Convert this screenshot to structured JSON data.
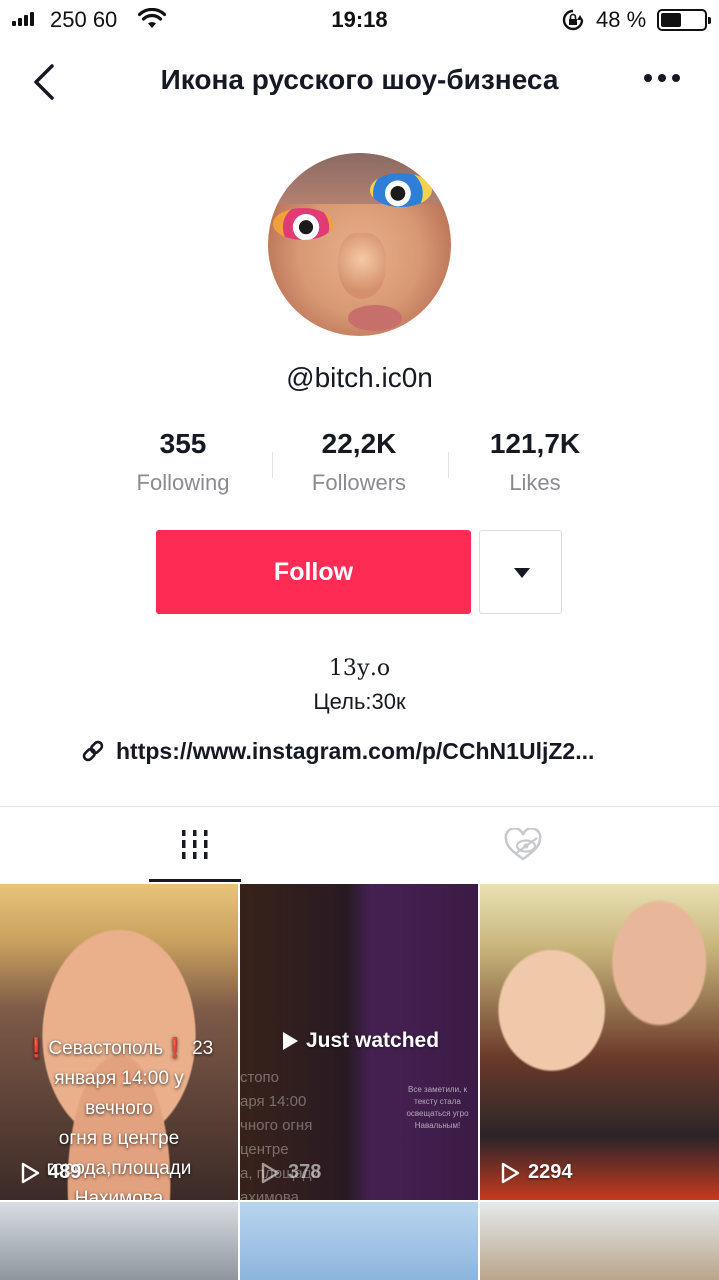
{
  "status_bar": {
    "carrier": "250 60",
    "time": "19:18",
    "battery_percent": "48 %",
    "battery_level": 0.48
  },
  "nav": {
    "title": "Икона русского шоу-бизнеса",
    "back_icon": "chevron-left-icon",
    "more_icon": "more-horizontal-icon"
  },
  "profile": {
    "username": "@bitch.ic0n",
    "stats": [
      {
        "value": "355",
        "label": "Following"
      },
      {
        "value": "22,2K",
        "label": "Followers"
      },
      {
        "value": "121,7K",
        "label": "Likes"
      }
    ],
    "follow_label": "Follow",
    "bio_line1": "13у.о",
    "bio_line2": "Цель:30к",
    "link": "https://www.instagram.com/p/CChN1UljZ2..."
  },
  "tabs": [
    {
      "name": "videos",
      "icon": "grid-bars-icon",
      "active": true
    },
    {
      "name": "liked",
      "icon": "heart-hidden-icon",
      "active": false
    }
  ],
  "videos": [
    {
      "views": "489",
      "caption_bang1": "❗",
      "caption_line1": "Севастополь",
      "caption_bang2": "❗",
      "caption_line1_end": "23",
      "caption_line2": "января 14:00 у",
      "caption_line3": "вечного",
      "caption_line4": "огня в центре",
      "caption_line5": "города,площади",
      "caption_line6": "Нахимова"
    },
    {
      "views": "378",
      "just_watched": "Just watched",
      "faded_caption": [
        "стопо",
        "аря 14:00",
        "чного огня",
        "центре",
        "а, площади",
        "ахимова"
      ],
      "small_text": "Все заметили, к тексту стала освещаться угро Навальным!"
    },
    {
      "views": "2294"
    },
    {
      "views": ""
    },
    {
      "views": ""
    },
    {
      "views": ""
    }
  ],
  "colors": {
    "accent": "#fe2c55",
    "text_primary": "#161823",
    "text_secondary": "#8a8b91"
  }
}
